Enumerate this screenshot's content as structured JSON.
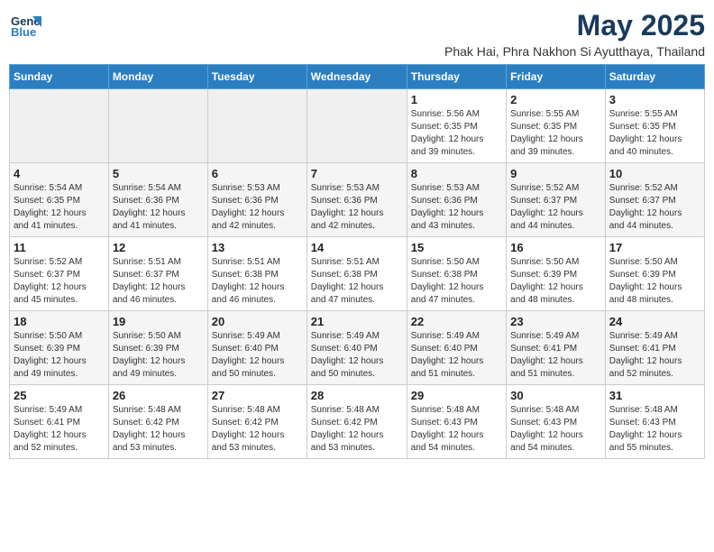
{
  "header": {
    "logo_general": "General",
    "logo_blue": "Blue",
    "month_title": "May 2025",
    "subtitle": "Phak Hai, Phra Nakhon Si Ayutthaya, Thailand"
  },
  "weekdays": [
    "Sunday",
    "Monday",
    "Tuesday",
    "Wednesday",
    "Thursday",
    "Friday",
    "Saturday"
  ],
  "weeks": [
    [
      {
        "day": "",
        "info": ""
      },
      {
        "day": "",
        "info": ""
      },
      {
        "day": "",
        "info": ""
      },
      {
        "day": "",
        "info": ""
      },
      {
        "day": "1",
        "info": "Sunrise: 5:56 AM\nSunset: 6:35 PM\nDaylight: 12 hours\nand 39 minutes."
      },
      {
        "day": "2",
        "info": "Sunrise: 5:55 AM\nSunset: 6:35 PM\nDaylight: 12 hours\nand 39 minutes."
      },
      {
        "day": "3",
        "info": "Sunrise: 5:55 AM\nSunset: 6:35 PM\nDaylight: 12 hours\nand 40 minutes."
      }
    ],
    [
      {
        "day": "4",
        "info": "Sunrise: 5:54 AM\nSunset: 6:35 PM\nDaylight: 12 hours\nand 41 minutes."
      },
      {
        "day": "5",
        "info": "Sunrise: 5:54 AM\nSunset: 6:36 PM\nDaylight: 12 hours\nand 41 minutes."
      },
      {
        "day": "6",
        "info": "Sunrise: 5:53 AM\nSunset: 6:36 PM\nDaylight: 12 hours\nand 42 minutes."
      },
      {
        "day": "7",
        "info": "Sunrise: 5:53 AM\nSunset: 6:36 PM\nDaylight: 12 hours\nand 42 minutes."
      },
      {
        "day": "8",
        "info": "Sunrise: 5:53 AM\nSunset: 6:36 PM\nDaylight: 12 hours\nand 43 minutes."
      },
      {
        "day": "9",
        "info": "Sunrise: 5:52 AM\nSunset: 6:37 PM\nDaylight: 12 hours\nand 44 minutes."
      },
      {
        "day": "10",
        "info": "Sunrise: 5:52 AM\nSunset: 6:37 PM\nDaylight: 12 hours\nand 44 minutes."
      }
    ],
    [
      {
        "day": "11",
        "info": "Sunrise: 5:52 AM\nSunset: 6:37 PM\nDaylight: 12 hours\nand 45 minutes."
      },
      {
        "day": "12",
        "info": "Sunrise: 5:51 AM\nSunset: 6:37 PM\nDaylight: 12 hours\nand 46 minutes."
      },
      {
        "day": "13",
        "info": "Sunrise: 5:51 AM\nSunset: 6:38 PM\nDaylight: 12 hours\nand 46 minutes."
      },
      {
        "day": "14",
        "info": "Sunrise: 5:51 AM\nSunset: 6:38 PM\nDaylight: 12 hours\nand 47 minutes."
      },
      {
        "day": "15",
        "info": "Sunrise: 5:50 AM\nSunset: 6:38 PM\nDaylight: 12 hours\nand 47 minutes."
      },
      {
        "day": "16",
        "info": "Sunrise: 5:50 AM\nSunset: 6:39 PM\nDaylight: 12 hours\nand 48 minutes."
      },
      {
        "day": "17",
        "info": "Sunrise: 5:50 AM\nSunset: 6:39 PM\nDaylight: 12 hours\nand 48 minutes."
      }
    ],
    [
      {
        "day": "18",
        "info": "Sunrise: 5:50 AM\nSunset: 6:39 PM\nDaylight: 12 hours\nand 49 minutes."
      },
      {
        "day": "19",
        "info": "Sunrise: 5:50 AM\nSunset: 6:39 PM\nDaylight: 12 hours\nand 49 minutes."
      },
      {
        "day": "20",
        "info": "Sunrise: 5:49 AM\nSunset: 6:40 PM\nDaylight: 12 hours\nand 50 minutes."
      },
      {
        "day": "21",
        "info": "Sunrise: 5:49 AM\nSunset: 6:40 PM\nDaylight: 12 hours\nand 50 minutes."
      },
      {
        "day": "22",
        "info": "Sunrise: 5:49 AM\nSunset: 6:40 PM\nDaylight: 12 hours\nand 51 minutes."
      },
      {
        "day": "23",
        "info": "Sunrise: 5:49 AM\nSunset: 6:41 PM\nDaylight: 12 hours\nand 51 minutes."
      },
      {
        "day": "24",
        "info": "Sunrise: 5:49 AM\nSunset: 6:41 PM\nDaylight: 12 hours\nand 52 minutes."
      }
    ],
    [
      {
        "day": "25",
        "info": "Sunrise: 5:49 AM\nSunset: 6:41 PM\nDaylight: 12 hours\nand 52 minutes."
      },
      {
        "day": "26",
        "info": "Sunrise: 5:48 AM\nSunset: 6:42 PM\nDaylight: 12 hours\nand 53 minutes."
      },
      {
        "day": "27",
        "info": "Sunrise: 5:48 AM\nSunset: 6:42 PM\nDaylight: 12 hours\nand 53 minutes."
      },
      {
        "day": "28",
        "info": "Sunrise: 5:48 AM\nSunset: 6:42 PM\nDaylight: 12 hours\nand 53 minutes."
      },
      {
        "day": "29",
        "info": "Sunrise: 5:48 AM\nSunset: 6:43 PM\nDaylight: 12 hours\nand 54 minutes."
      },
      {
        "day": "30",
        "info": "Sunrise: 5:48 AM\nSunset: 6:43 PM\nDaylight: 12 hours\nand 54 minutes."
      },
      {
        "day": "31",
        "info": "Sunrise: 5:48 AM\nSunset: 6:43 PM\nDaylight: 12 hours\nand 55 minutes."
      }
    ]
  ]
}
